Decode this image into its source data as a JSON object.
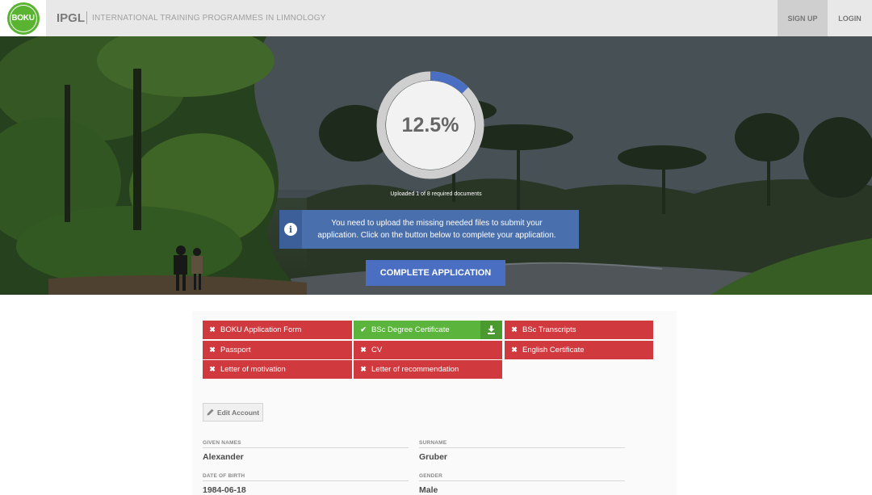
{
  "header": {
    "logo_text": "BOKU",
    "brand": "IPGL",
    "tagline": "INTERNATIONAL TRAINING PROGRAMMES IN LIMNOLOGY",
    "nav": {
      "signup": "SIGN UP",
      "login": "LOGIN"
    }
  },
  "progress": {
    "percent_label": "12.5%",
    "fraction": 0.125,
    "uploaded_note": "Uploaded 1 of 8 required documents"
  },
  "info": {
    "icon": "info-icon",
    "message": "You need to upload the missing needed files to submit your application. Click on the button below to complete your application."
  },
  "complete_button": "COMPLETE APPLICATION",
  "documents": [
    {
      "label": "BOKU Application Form",
      "status": "missing"
    },
    {
      "label": "BSc Degree Certificate",
      "status": "uploaded"
    },
    {
      "label": "BSc Transcripts",
      "status": "missing"
    },
    {
      "label": "Passport",
      "status": "missing"
    },
    {
      "label": "CV",
      "status": "missing"
    },
    {
      "label": "English Certificate",
      "status": "missing"
    },
    {
      "label": "Letter of motivation",
      "status": "missing"
    },
    {
      "label": "Letter of recommendation",
      "status": "missing"
    }
  ],
  "account": {
    "edit_label": "Edit Account",
    "given_names_label": "GIVEN NAMES",
    "given_names": "Alexander",
    "surname_label": "SURNAME",
    "surname": "Gruber",
    "dob_label": "DATE OF BIRTH",
    "dob": "1984-06-18",
    "gender_label": "GENDER",
    "gender": "Male"
  },
  "colors": {
    "missing": "#d0393e",
    "uploaded": "#5bb43c",
    "primary": "#4a6fc2",
    "brand_green": "#5ab432"
  }
}
